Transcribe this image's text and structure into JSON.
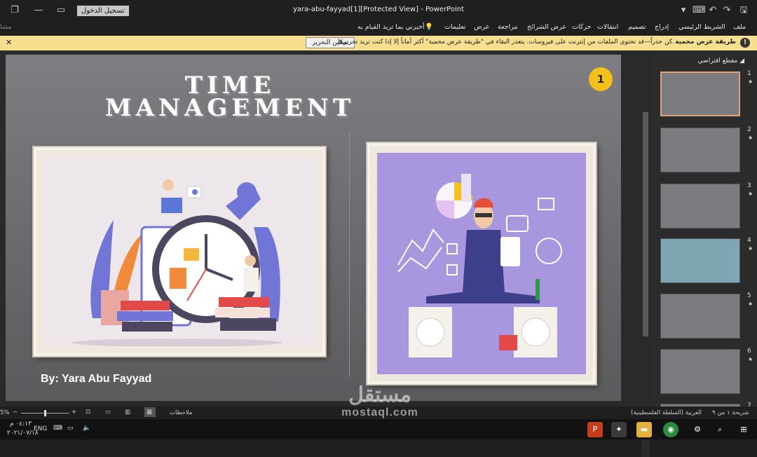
{
  "window": {
    "doc_title": "yara-abu-fayyad[1][Protected View]  -  PowerPoint",
    "signin": "تسجيل الدخول"
  },
  "ribbon": {
    "tabs": [
      "ملف",
      "الشريط الرئيسي",
      "إدراج",
      "تصميم",
      "انتقالات",
      "حركات",
      "عرض الشرائح",
      "مراجعة",
      "عرض",
      "تعليمات",
      "أخبرني بما تريد القيام به"
    ],
    "share": "مشا"
  },
  "infobar": {
    "title": "طريقة عرض محمية",
    "message": "كن حذراً—قد تحتوي الملفات من إنترنت على فيروسات. يتعذر البقاء في \"طريقة عرض محمية\" أكثر أماناً إلا إذا كنت تريد تحريرها.",
    "enable_button": "تمكين التحرير"
  },
  "slide": {
    "title_line1": "TIME",
    "title_line2": "MANAGEMENT",
    "number_badge": "1",
    "author": "By: Yara Abu Fayyad"
  },
  "thumbnails": {
    "section_label": "مقطع افتراضي",
    "items": [
      {
        "num": "1"
      },
      {
        "num": "2"
      },
      {
        "num": "3"
      },
      {
        "num": "4"
      },
      {
        "num": "5"
      },
      {
        "num": "6"
      },
      {
        "num": "7"
      }
    ]
  },
  "statusbar": {
    "slide_count": "شريحة ١ من ٩",
    "language": "العربية (السلطة الفلسطينية)",
    "notes": "ملاحظات",
    "zoom": "5%"
  },
  "taskbar": {
    "time": "٠٤:١٣ م",
    "date": "٢٠٢١/٠٧/١٨",
    "lang": "ENG"
  },
  "watermark": {
    "line1": "مستقل",
    "line2": "mostaql.com"
  },
  "colors": {
    "accent_yellow": "#f4c01a",
    "infobar": "#f6e08f",
    "right_image_bg": "#a897de"
  }
}
